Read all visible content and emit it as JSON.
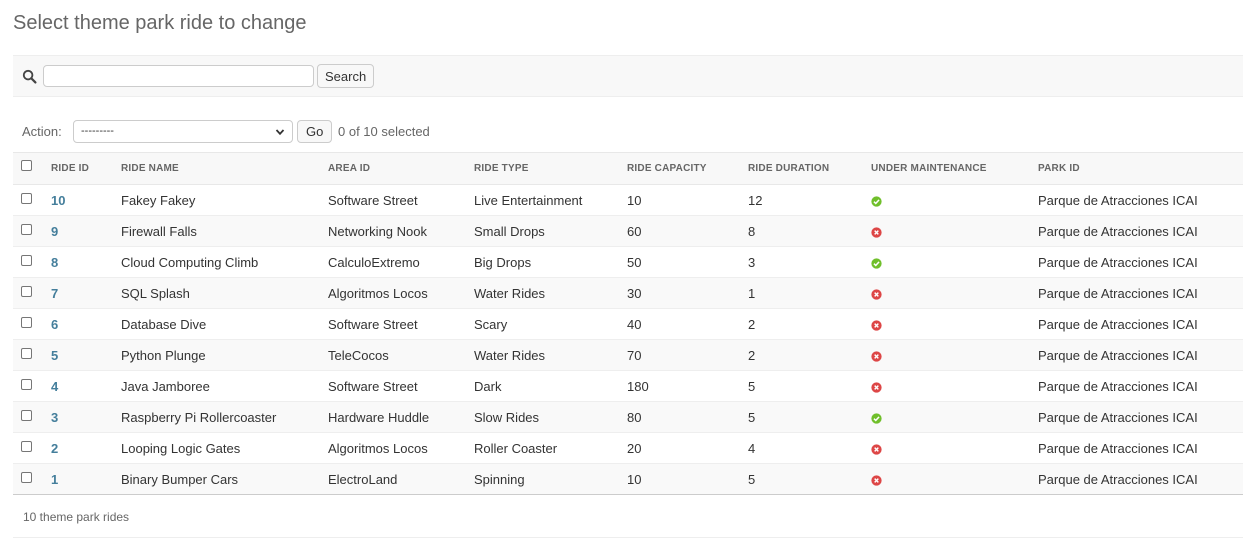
{
  "page_title": "Select theme park ride to change",
  "search": {
    "placeholder": "",
    "value": "",
    "button_label": "Search"
  },
  "actions": {
    "label": "Action:",
    "selected_option": "---------",
    "go_label": "Go",
    "counter": "0 of 10 selected"
  },
  "table": {
    "columns": [
      "RIDE ID",
      "RIDE NAME",
      "AREA ID",
      "RIDE TYPE",
      "RIDE CAPACITY",
      "RIDE DURATION",
      "UNDER MAINTENANCE",
      "PARK ID"
    ],
    "rows": [
      {
        "id": "10",
        "name": "Fakey Fakey",
        "area": "Software Street",
        "type": "Live Entertainment",
        "capacity": "10",
        "duration": "12",
        "maintenance": "yes",
        "park": "Parque de Atracciones ICAI"
      },
      {
        "id": "9",
        "name": "Firewall Falls",
        "area": "Networking Nook",
        "type": "Small Drops",
        "capacity": "60",
        "duration": "8",
        "maintenance": "no",
        "park": "Parque de Atracciones ICAI"
      },
      {
        "id": "8",
        "name": "Cloud Computing Climb",
        "area": "CalculoExtremo",
        "type": "Big Drops",
        "capacity": "50",
        "duration": "3",
        "maintenance": "yes",
        "park": "Parque de Atracciones ICAI"
      },
      {
        "id": "7",
        "name": "SQL Splash",
        "area": "Algoritmos Locos",
        "type": "Water Rides",
        "capacity": "30",
        "duration": "1",
        "maintenance": "no",
        "park": "Parque de Atracciones ICAI"
      },
      {
        "id": "6",
        "name": "Database Dive",
        "area": "Software Street",
        "type": "Scary",
        "capacity": "40",
        "duration": "2",
        "maintenance": "no",
        "park": "Parque de Atracciones ICAI"
      },
      {
        "id": "5",
        "name": "Python Plunge",
        "area": "TeleCocos",
        "type": "Water Rides",
        "capacity": "70",
        "duration": "2",
        "maintenance": "no",
        "park": "Parque de Atracciones ICAI"
      },
      {
        "id": "4",
        "name": "Java Jamboree",
        "area": "Software Street",
        "type": "Dark",
        "capacity": "180",
        "duration": "5",
        "maintenance": "no",
        "park": "Parque de Atracciones ICAI"
      },
      {
        "id": "3",
        "name": "Raspberry Pi Rollercoaster",
        "area": "Hardware Huddle",
        "type": "Slow Rides",
        "capacity": "80",
        "duration": "5",
        "maintenance": "yes",
        "park": "Parque de Atracciones ICAI"
      },
      {
        "id": "2",
        "name": "Looping Logic Gates",
        "area": "Algoritmos Locos",
        "type": "Roller Coaster",
        "capacity": "20",
        "duration": "4",
        "maintenance": "no",
        "park": "Parque de Atracciones ICAI"
      },
      {
        "id": "1",
        "name": "Binary Bumper Cars",
        "area": "ElectroLand",
        "type": "Spinning",
        "capacity": "10",
        "duration": "5",
        "maintenance": "no",
        "park": "Parque de Atracciones ICAI"
      }
    ]
  },
  "footer": {
    "count_text": "10 theme park rides"
  },
  "colors": {
    "link": "#447e9b",
    "yes": "#70bf2b",
    "no": "#dd4646"
  },
  "icons": {
    "search": "search-icon",
    "yes": "icon-yes",
    "no": "icon-no"
  }
}
